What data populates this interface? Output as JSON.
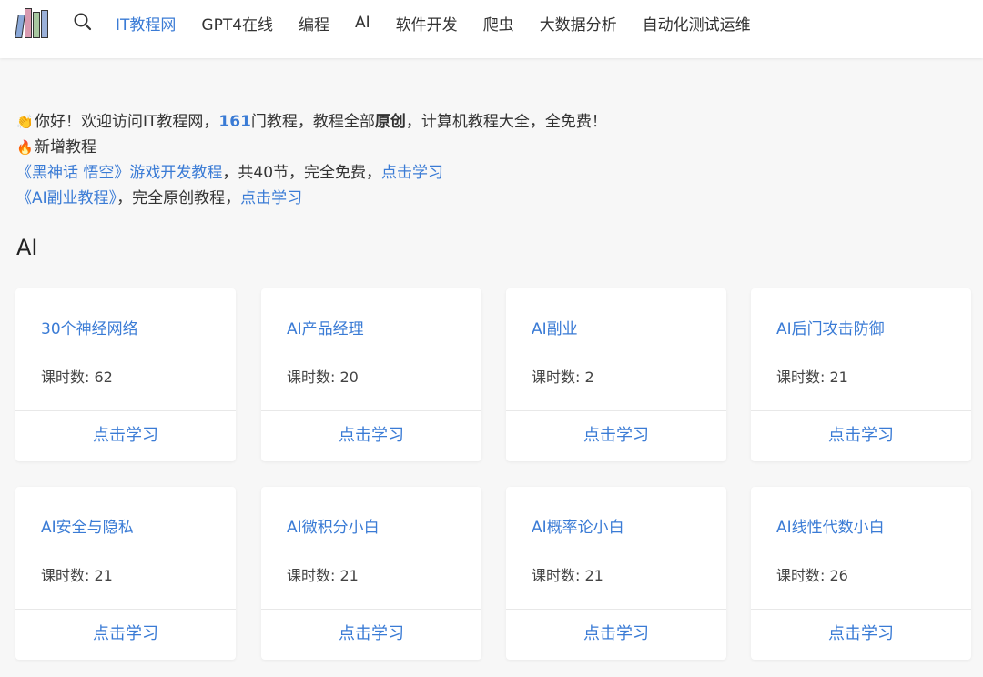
{
  "nav": {
    "items": [
      {
        "label": "IT教程网",
        "active": true
      },
      {
        "label": "GPT4在线",
        "active": false
      },
      {
        "label": "编程",
        "active": false
      },
      {
        "label": "AI",
        "active": false
      },
      {
        "label": "软件开发",
        "active": false
      },
      {
        "label": "爬虫",
        "active": false
      },
      {
        "label": "大数据分析",
        "active": false
      },
      {
        "label": "自动化测试运维",
        "active": false
      }
    ],
    "icons": {
      "logo": "books-logo",
      "search": "search-icon"
    }
  },
  "intro": {
    "wave_emoji": "👏",
    "greeting_prefix": "你好！欢迎访问IT教程网，",
    "count": "161",
    "greeting_mid": "门教程，教程全部",
    "original": "原创",
    "greeting_suffix": "，计算机教程大全，全免费！",
    "fire_emoji": "🔥",
    "new_label": "新增教程",
    "line1_title": "《黑神话 悟空》游戏开发教程",
    "line1_mid": "，共40节，完全免费，",
    "line1_link": "点击学习",
    "line2_title": "《AI副业教程》",
    "line2_mid": "，完全原创教程，",
    "line2_link": "点击学习"
  },
  "section": {
    "title": "AI"
  },
  "hours_label": "课时数: ",
  "cards": [
    {
      "title": "30个神经网络",
      "hours": "62",
      "button": "点击学习"
    },
    {
      "title": "AI产品经理",
      "hours": "20",
      "button": "点击学习"
    },
    {
      "title": "AI副业",
      "hours": "2",
      "button": "点击学习"
    },
    {
      "title": "AI后门攻击防御",
      "hours": "21",
      "button": "点击学习"
    },
    {
      "title": "AI安全与隐私",
      "hours": "21",
      "button": "点击学习"
    },
    {
      "title": "AI微积分小白",
      "hours": "21",
      "button": "点击学习"
    },
    {
      "title": "AI概率论小白",
      "hours": "21",
      "button": "点击学习"
    },
    {
      "title": "AI线性代数小白",
      "hours": "26",
      "button": "点击学习"
    }
  ],
  "colors": {
    "accent": "#3a7bd5",
    "background": "#f7f7f7",
    "card": "#ffffff"
  }
}
